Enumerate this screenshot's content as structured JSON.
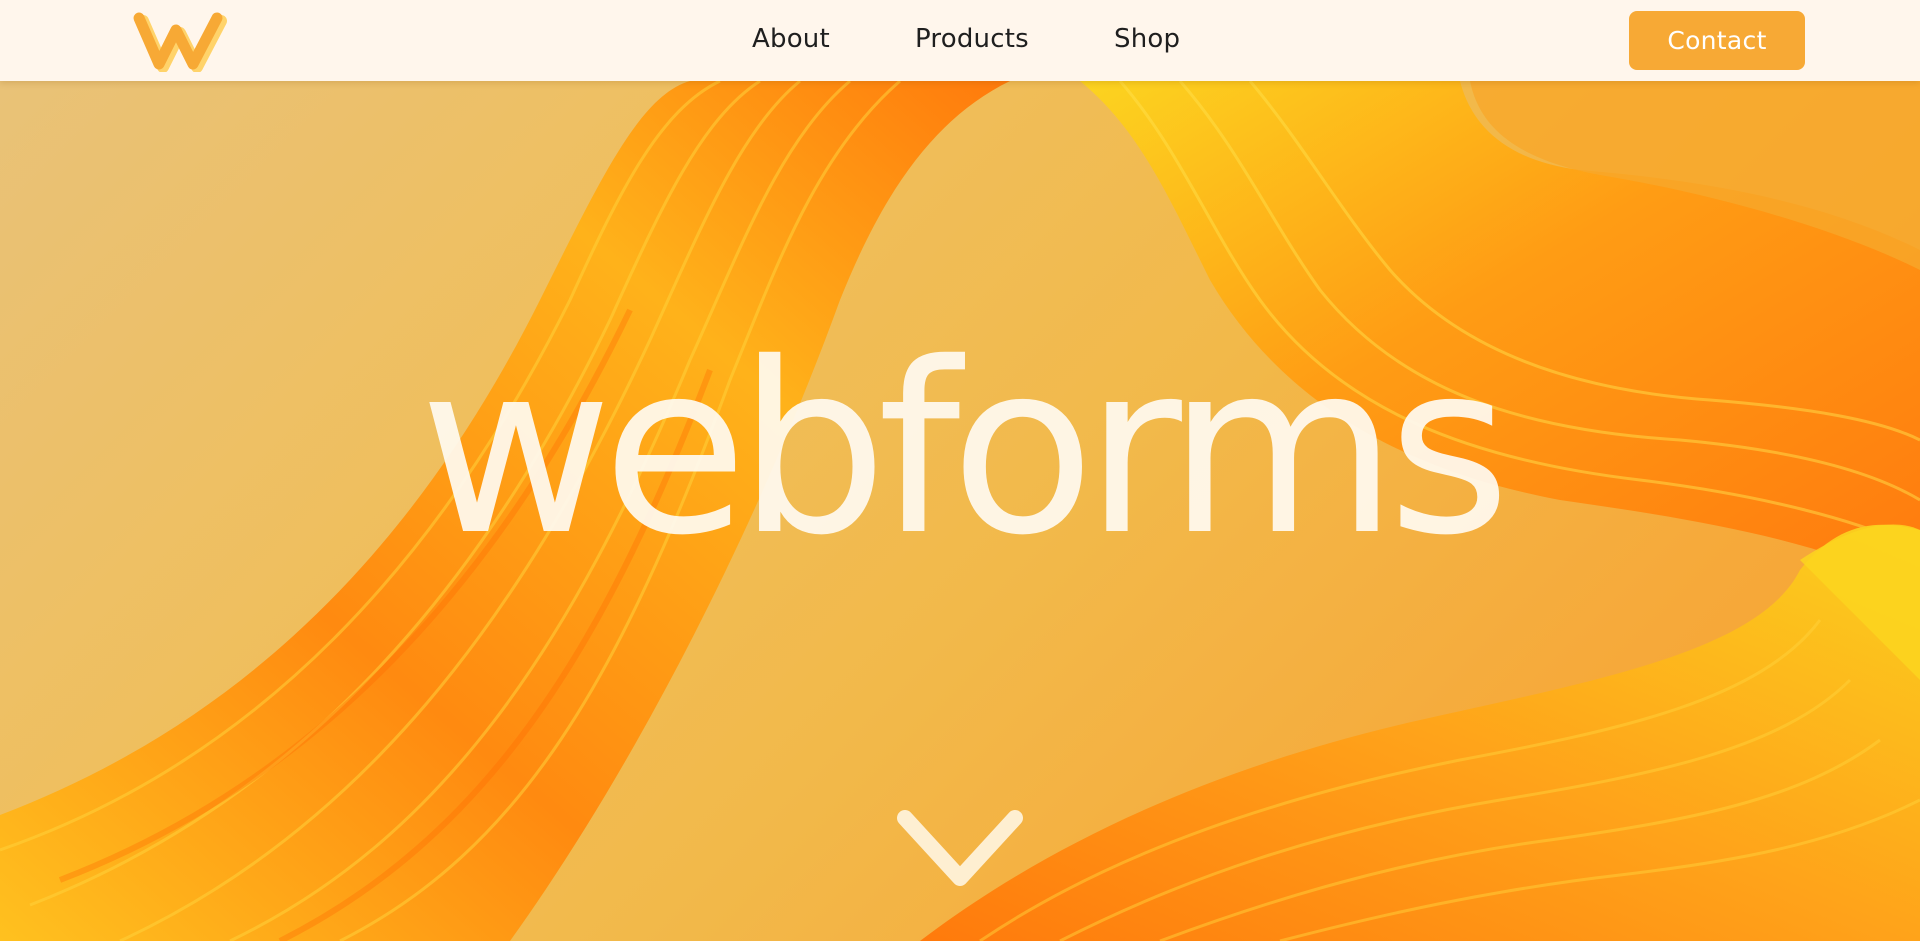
{
  "header": {
    "logo_letter": "W",
    "nav": {
      "about": "About",
      "products": "Products",
      "shop": "Shop"
    },
    "contact_label": "Contact"
  },
  "hero": {
    "title": "webforms",
    "scroll_icon": "chevron-down-icon"
  },
  "colors": {
    "accent": "#f7a935",
    "header_bg": "#fff6ec",
    "nav_text": "#1f1f1f",
    "hero_text": "#fffaf0",
    "ribbon_orange": "#ff7a10",
    "ribbon_yellow": "#fbd51f"
  }
}
